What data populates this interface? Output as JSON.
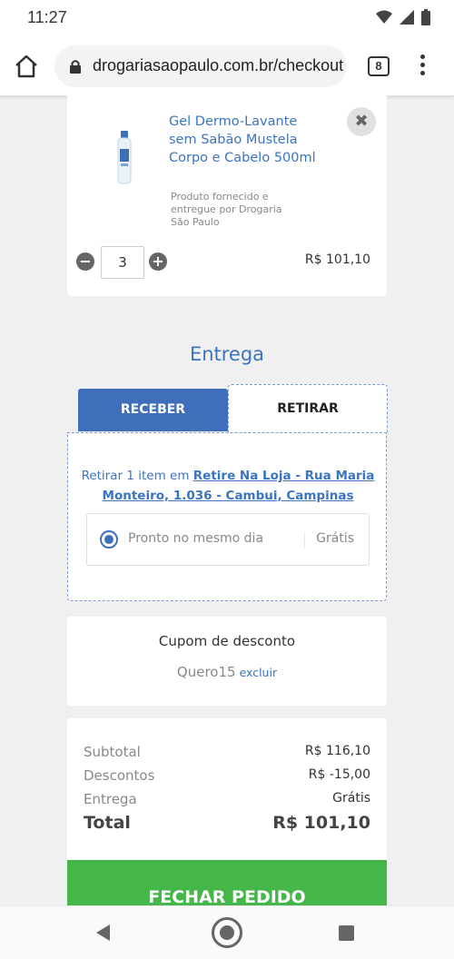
{
  "status_bar": {
    "time": "11:27"
  },
  "browser": {
    "url": "drogariasaopaulo.com.br/checkout",
    "tab_count": "8"
  },
  "product": {
    "name": "Gel Dermo-Lavante sem Sabão Mustela Corpo e Cabelo 500ml",
    "vendor": "Produto fornecido e entregue por Drogaria São Paulo",
    "quantity": "3",
    "price": "R$ 101,10",
    "remove_symbol": "✖",
    "minus_symbol": "−",
    "plus_symbol": "+"
  },
  "delivery": {
    "title": "Entrega",
    "tabs": {
      "receive": "RECEBER",
      "pickup": "RETIRAR"
    },
    "pickup_prefix": "Retirar 1 item em ",
    "store": "Retire Na Loja - Rua Maria Monteiro, 1.036 - Cambui, Campinas",
    "option_label": "Pronto no mesmo dia",
    "option_price": "Grátis"
  },
  "coupon": {
    "title": "Cupom de desconto",
    "code": "Quero15",
    "remove_label": "excluir"
  },
  "totals": {
    "subtotal_label": "Subtotal",
    "subtotal_value": "R$ 116,10",
    "discount_label": "Descontos",
    "discount_value": "R$ -15,00",
    "shipping_label": "Entrega",
    "shipping_value": "Grátis",
    "total_label": "Total",
    "total_value": "R$ 101,10"
  },
  "checkout_button": "FECHAR PEDIDO",
  "colors": {
    "primary_blue": "#3f6fbb",
    "link_blue": "#3b74c0",
    "checkout_green": "#45b649"
  },
  "icons": [
    "wifi-icon",
    "signal-icon",
    "battery-icon",
    "home-icon",
    "lock-icon",
    "menu-icon",
    "close-icon",
    "minus-icon",
    "plus-icon",
    "radio-icon",
    "back-icon",
    "home-nav-icon",
    "recents-icon"
  ]
}
